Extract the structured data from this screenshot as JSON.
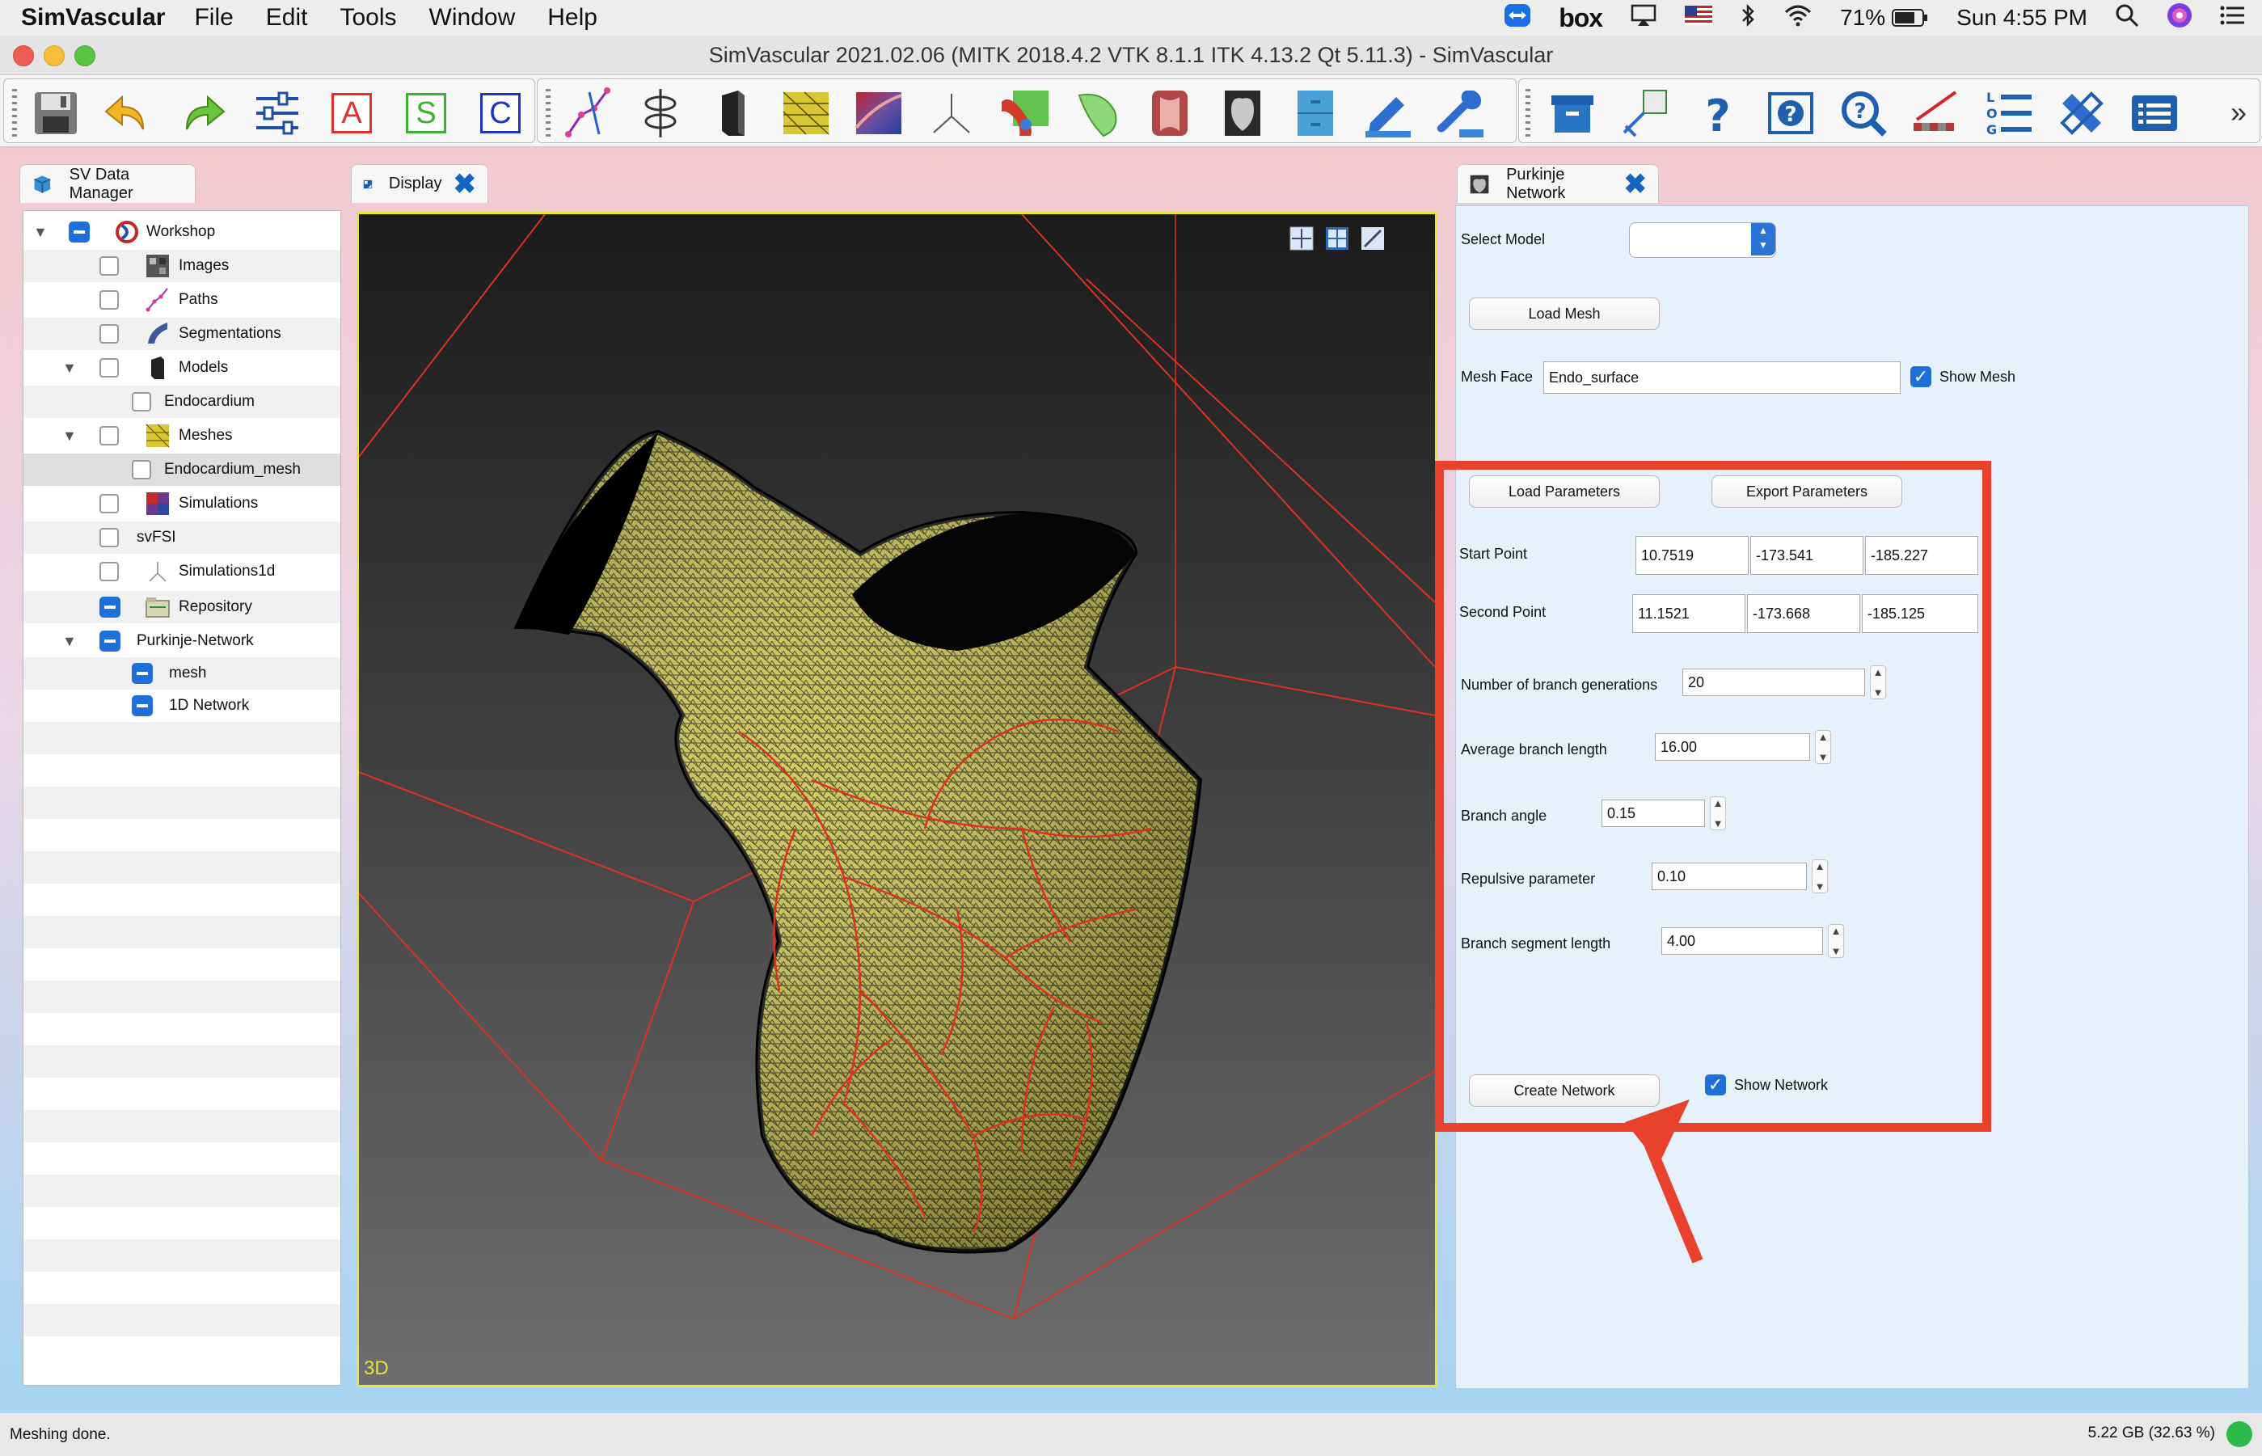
{
  "menubar": {
    "app_name": "SimVascular",
    "items": [
      "File",
      "Edit",
      "Tools",
      "Window",
      "Help"
    ],
    "status_icons": [
      "teamviewer-icon",
      "box-icon",
      "airplay-icon",
      "us-flag-icon",
      "bluetooth-icon",
      "wifi-icon",
      "battery-icon",
      "search-icon",
      "siri-icon",
      "control-center-icon"
    ],
    "box_label": "box",
    "battery": "71%",
    "clock": "Sun 4:55 PM"
  },
  "window": {
    "title": "SimVascular 2021.02.06 (MITK 2018.4.2 VTK 8.1.1 ITK 4.13.2 Qt 5.11.3) - SimVascular"
  },
  "toolbar": {
    "letter_a": "A",
    "letter_s": "S",
    "letter_c": "C",
    "more": "»"
  },
  "data_manager": {
    "tab_label": "SV Data Manager",
    "items": [
      {
        "label": "Workshop"
      },
      {
        "label": "Images"
      },
      {
        "label": "Paths"
      },
      {
        "label": "Segmentations"
      },
      {
        "label": "Models"
      },
      {
        "label": "Endocardium"
      },
      {
        "label": "Meshes"
      },
      {
        "label": "Endocardium_mesh"
      },
      {
        "label": "Simulations"
      },
      {
        "label": "svFSI"
      },
      {
        "label": "Simulations1d"
      },
      {
        "label": "Repository"
      },
      {
        "label": "Purkinje-Network"
      },
      {
        "label": "mesh"
      },
      {
        "label": "1D Network"
      }
    ]
  },
  "display": {
    "tab_label": "Display",
    "view_label": "3D"
  },
  "purkinje": {
    "tab_label": "Purkinje Network",
    "select_model_label": "Select Model",
    "select_model_value": "",
    "load_mesh": "Load Mesh",
    "mesh_face_label": "Mesh Face",
    "mesh_face_value": "Endo_surface",
    "show_mesh": "Show Mesh",
    "load_params": "Load Parameters",
    "export_params": "Export Parameters",
    "start_point_label": "Start Point",
    "start_point": [
      "10.7519",
      "-173.541",
      "-185.227"
    ],
    "second_point_label": "Second Point",
    "second_point": [
      "11.1521",
      "-173.668",
      "-185.125"
    ],
    "branch_generations_label": "Number of branch generations",
    "branch_generations": "20",
    "avg_branch_length_label": "Average branch length",
    "avg_branch_length": "16.00",
    "branch_angle_label": "Branch angle",
    "branch_angle": "0.15",
    "repulsive_label": "Repulsive parameter",
    "repulsive": "0.10",
    "segment_length_label": "Branch segment length",
    "segment_length": "4.00",
    "create_network": "Create Network",
    "show_network": "Show Network"
  },
  "status": {
    "message": "Meshing done.",
    "memory": "5.22 GB (32.63 %)"
  },
  "colors": {
    "highlight": "#e8412c",
    "accent": "#1e6fd9",
    "mesh": "#c8c040",
    "network": "#e03020"
  }
}
